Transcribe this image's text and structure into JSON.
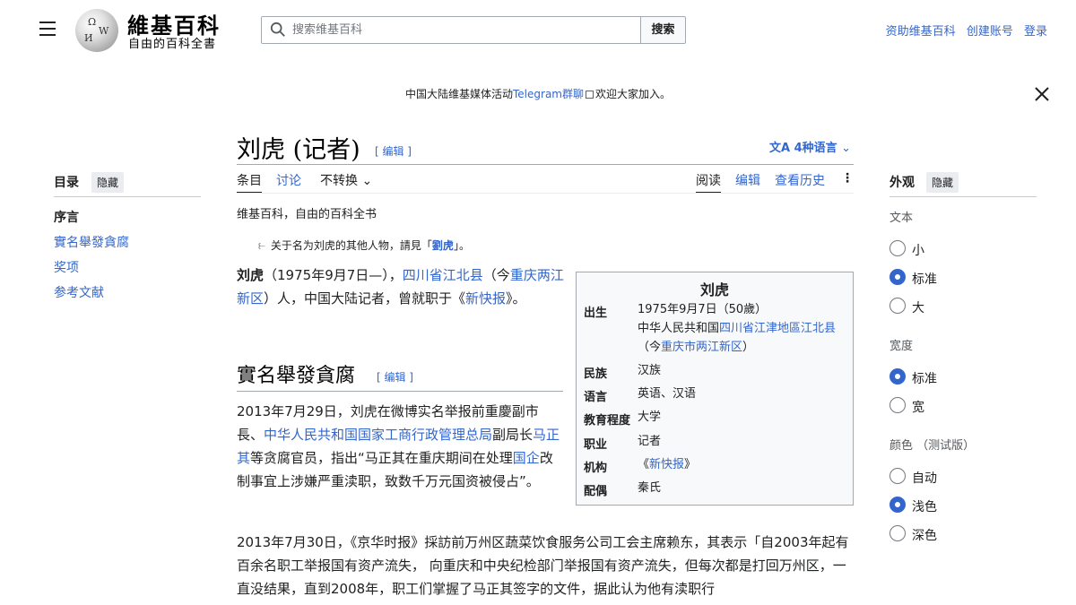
{
  "header": {
    "logo_title": "維基百科",
    "logo_tagline": "自由的百科全書",
    "search_placeholder": "搜索维基百科",
    "search_button": "搜索",
    "links": [
      "资助维基百科",
      "创建账号",
      "登录"
    ]
  },
  "banner": {
    "prefix": "中国大陆维基媒体活动",
    "link": "Telegram群聊",
    "suffix": "欢迎大家加入。"
  },
  "title": {
    "text": "刘虎 (记者)",
    "edit": "[ 编辑 ]",
    "languages": "4种语言"
  },
  "tabs": {
    "left": [
      "条目",
      "讨论",
      "不转换"
    ],
    "right": [
      "阅读",
      "编辑",
      "查看历史"
    ]
  },
  "toc": {
    "title": "目录",
    "hide": "隐藏",
    "items": [
      "序言",
      "實名舉發貪腐",
      "奖项",
      "参考文献"
    ]
  },
  "appearance": {
    "title": "外观",
    "hide": "隐藏",
    "text_label": "文本",
    "text_options": [
      "小",
      "标准",
      "大"
    ],
    "text_selected": 1,
    "width_label": "宽度",
    "width_options": [
      "标准",
      "宽"
    ],
    "width_selected": 0,
    "color_label": "颜色 （测试版）",
    "color_options": [
      "自动",
      "浅色",
      "深色"
    ],
    "color_selected": 1
  },
  "content": {
    "from": "维基百科，自由的百科全书",
    "hatnote_prefix": "关于名为刘虎的其他人物，請見「",
    "hatnote_link": "劉虎",
    "hatnote_suffix": "」。",
    "lead": {
      "name": "刘虎",
      "p1": "（1975年9月7日—），",
      "place_link": "四川省江北县",
      "p2": "（今",
      "place2_link": "重庆两江新区",
      "p3": "）人，中国大陆记者，曾就职于《",
      "paper_link": "新快报",
      "p4": "》。"
    },
    "section1": {
      "heading": "實名舉發貪腐",
      "edit": "[ 编辑 ]",
      "para1": {
        "a": "2013年7月29日，刘虎在微博实名举报前重慶副市長、",
        "link1": "中华人民共和国国家工商行政管理总局",
        "b": "副局长",
        "link2": "马正其",
        "c": "等贪腐官员，指出“马正其在重庆期间在处理",
        "link3": "国企",
        "d": "改制事宜上涉嫌严重渎职，致数千万元国资被侵占”。"
      },
      "para2": "2013年7月30日，《京华时报》採訪前万州区蔬菜饮食服务公司工会主席赖东，其表示「自2003年起有百余名职工举报国有资产流失， 向重庆和中央纪检部门举报国有资产流失，但每次都是打回万州区，一直没结果，直到2008年，职工们掌握了马正其签字的文件，据此认为他有渎职行"
    }
  },
  "infobox": {
    "title": "刘虎",
    "rows": [
      {
        "k": "出生",
        "v": "1975年9月7日（50歲）"
      },
      {
        "k": "民族",
        "v": "汉族"
      },
      {
        "k": "语言",
        "v": "英语、汉语"
      },
      {
        "k": "教育程度",
        "v": "大学"
      },
      {
        "k": "职业",
        "v": "记者"
      },
      {
        "k": "机构",
        "v": "《新快报》"
      },
      {
        "k": "配偶",
        "v": "秦氏"
      }
    ],
    "birth_line2_a": "中华人民共和国",
    "birth_line2_link": "四川省江津地區江北县",
    "birth_line3_a": "（今",
    "birth_line3_link": "重庆市两江新区",
    "birth_line3_b": "）",
    "org_link": "新快报"
  }
}
